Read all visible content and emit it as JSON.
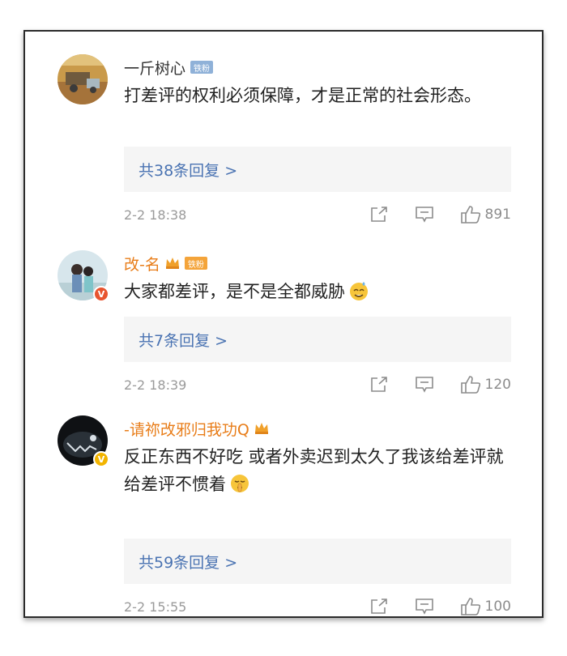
{
  "comments": [
    {
      "name": "一斤树心",
      "fan_badge": "铁粉",
      "text": "打差评的权利必须保障，才是正常的社会形态。",
      "reply_label": "共38条回复 >",
      "time": "2-2 18:38",
      "likes": "891",
      "icons": {
        "share": "share-icon",
        "comment": "comment-icon",
        "like": "thumbs-up-icon"
      }
    },
    {
      "name": "改-名",
      "fan_badge": "铁粉",
      "text": "大家都差评，是不是全都威胁",
      "reply_label": "共7条回复 >",
      "time": "2-2 18:39",
      "likes": "120",
      "emoji": "sweat-smile-emoji",
      "verified": "red"
    },
    {
      "name": "-请祢改邪归我功Q",
      "text": "反正东西不好吃 或者外卖迟到太久了我该给差评就给差评不惯着",
      "reply_label": "共59条回复 >",
      "time": "2-2 15:55",
      "likes": "100",
      "emoji": "shush-emoji",
      "verified": "gold"
    }
  ],
  "colors": {
    "link": "#4a73b2",
    "orange_name": "#e87d19",
    "reply_bg": "#f5f5f5",
    "meta": "#9a9a9a"
  }
}
